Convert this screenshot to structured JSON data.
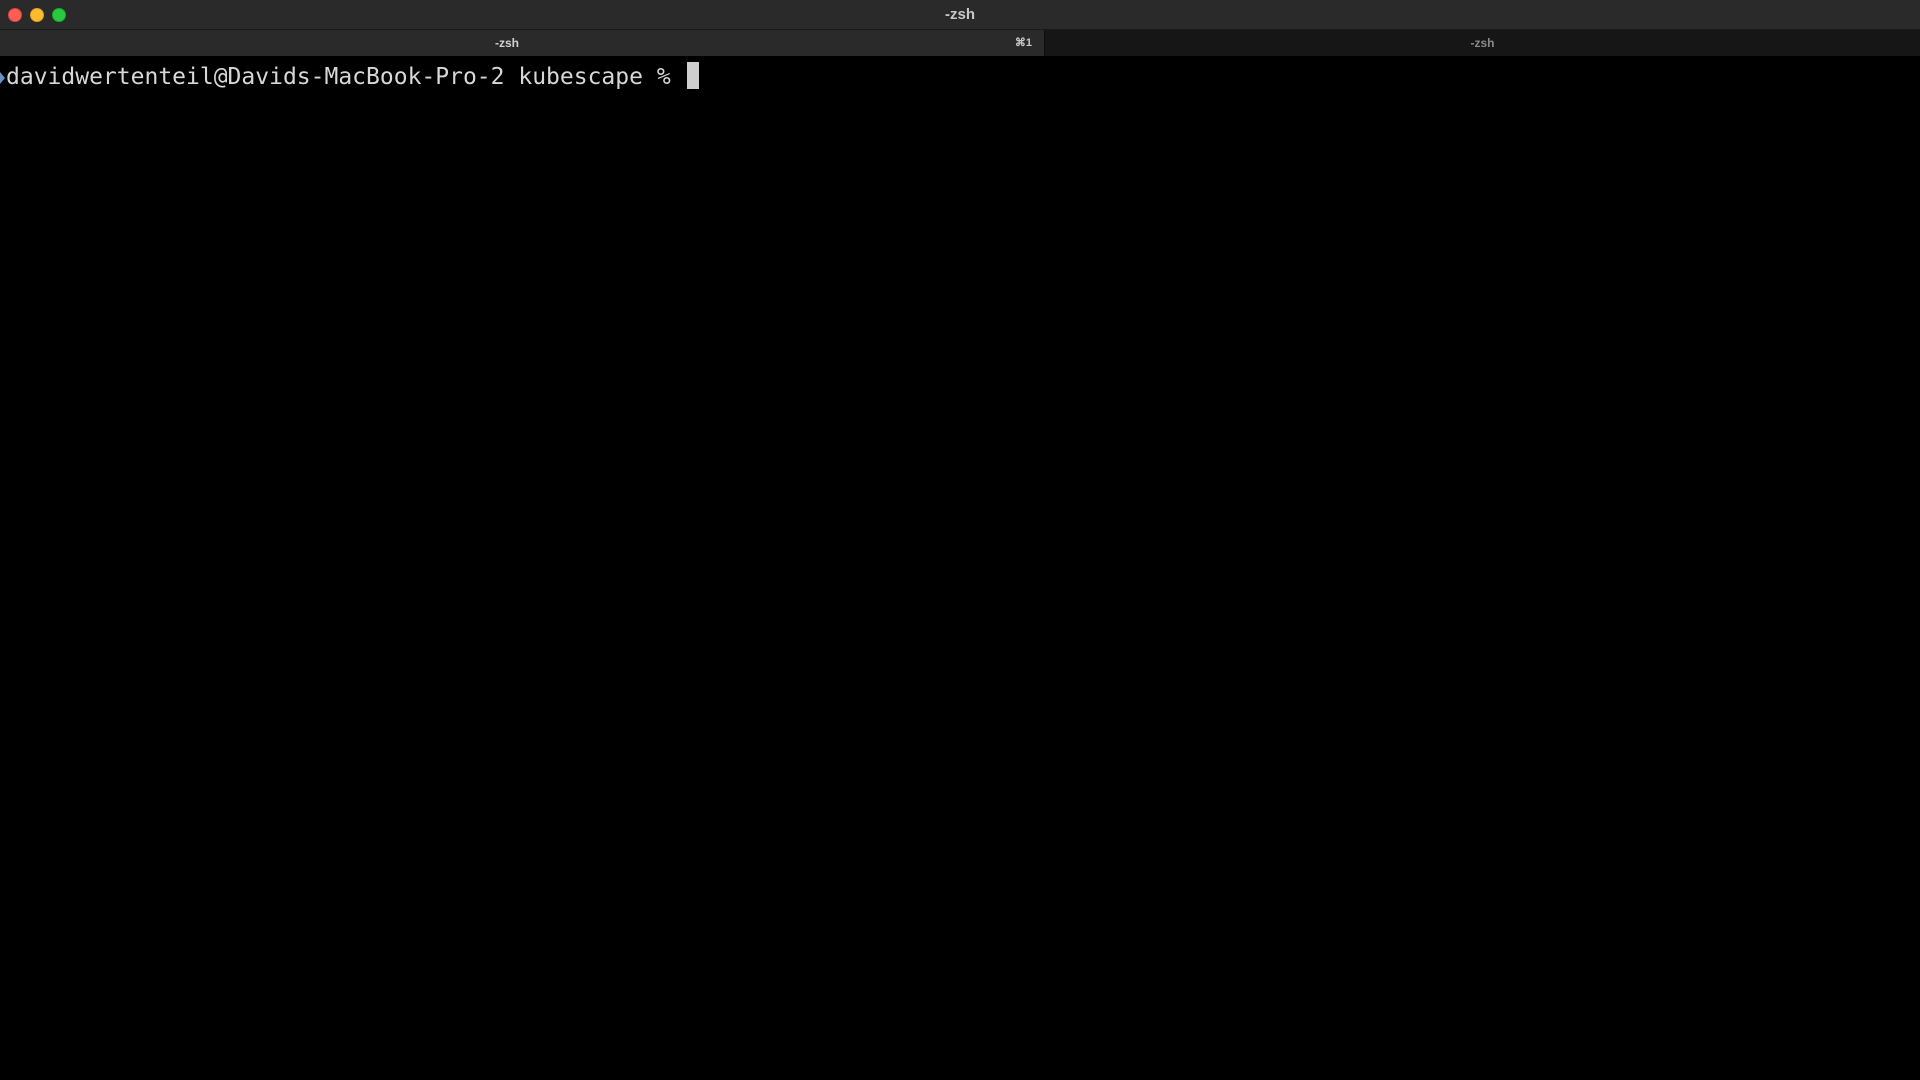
{
  "window": {
    "title": "-zsh"
  },
  "tabs": [
    {
      "label": "-zsh",
      "shortcut": "⌘1",
      "active": true
    },
    {
      "label": "-zsh",
      "active": false
    }
  ],
  "terminal": {
    "prompt": "davidwertenteil@Davids-MacBook-Pro-2 kubescape % ",
    "input": ""
  },
  "colors": {
    "background": "#000000",
    "text": "#d7d7d7",
    "close": "#ff5f57",
    "minimize": "#febc2e",
    "maximize": "#28c840"
  }
}
